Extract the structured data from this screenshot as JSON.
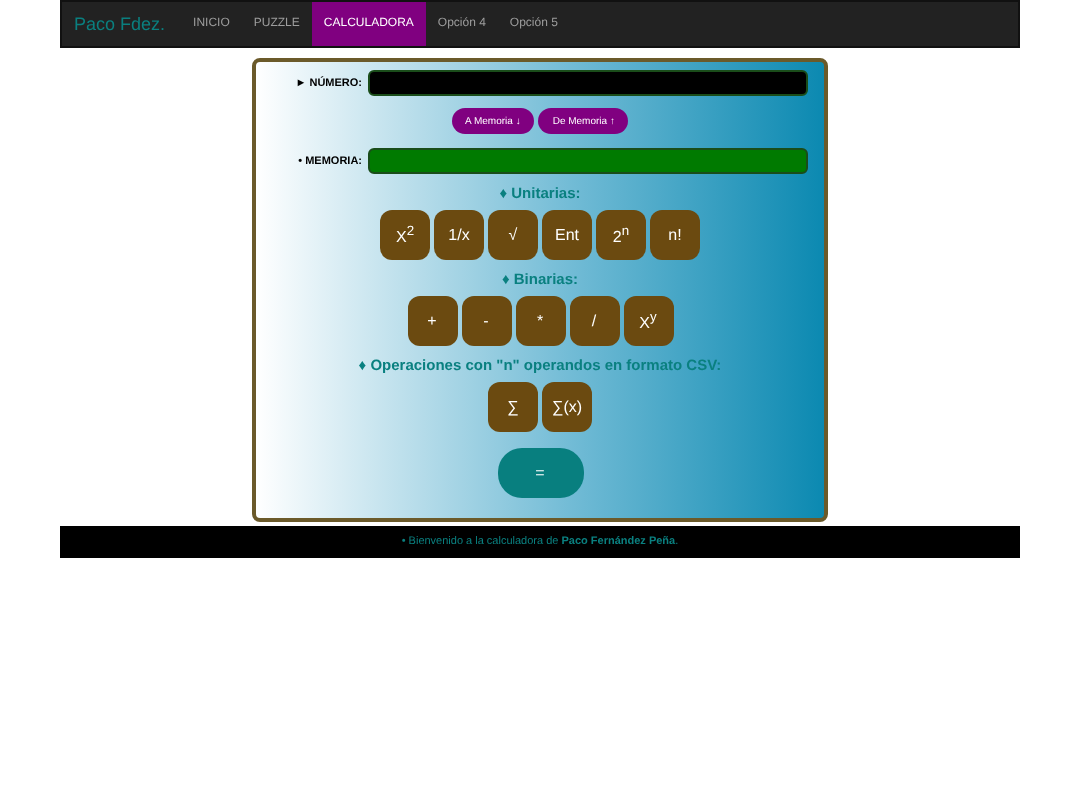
{
  "navbar": {
    "brand": "Paco Fdez.",
    "items": [
      {
        "label": "INICIO",
        "selected": false
      },
      {
        "label": "PUZZLE",
        "selected": false
      },
      {
        "label": "CALCULADORA",
        "selected": true
      },
      {
        "label": "Opción 4",
        "selected": false
      },
      {
        "label": "Opción 5",
        "selected": false
      }
    ]
  },
  "calculator": {
    "number_label": "► NÚMERO:",
    "memory_buttons": [
      "A Memoria ↓",
      "De Memoria ↑"
    ],
    "memory_label": "• MEMORIA:",
    "sections": [
      {
        "title": "♦ Unitarias:",
        "buttons": [
          "X$^{2}$",
          "1/x",
          "√",
          "Ent",
          "2$^{n}$",
          "n!"
        ]
      },
      {
        "title": "♦ Binarias:",
        "buttons": [
          "+",
          "-",
          "*",
          "/",
          "X$^{y}$"
        ]
      },
      {
        "title": "♦ Operaciones con \"n\" operandos en formato CSV:",
        "buttons": [
          "∑",
          "∑(x)"
        ]
      }
    ],
    "equals": "="
  },
  "footer": "• Bienvenido a la calculadora de **Paco Fernández Peña**."
}
